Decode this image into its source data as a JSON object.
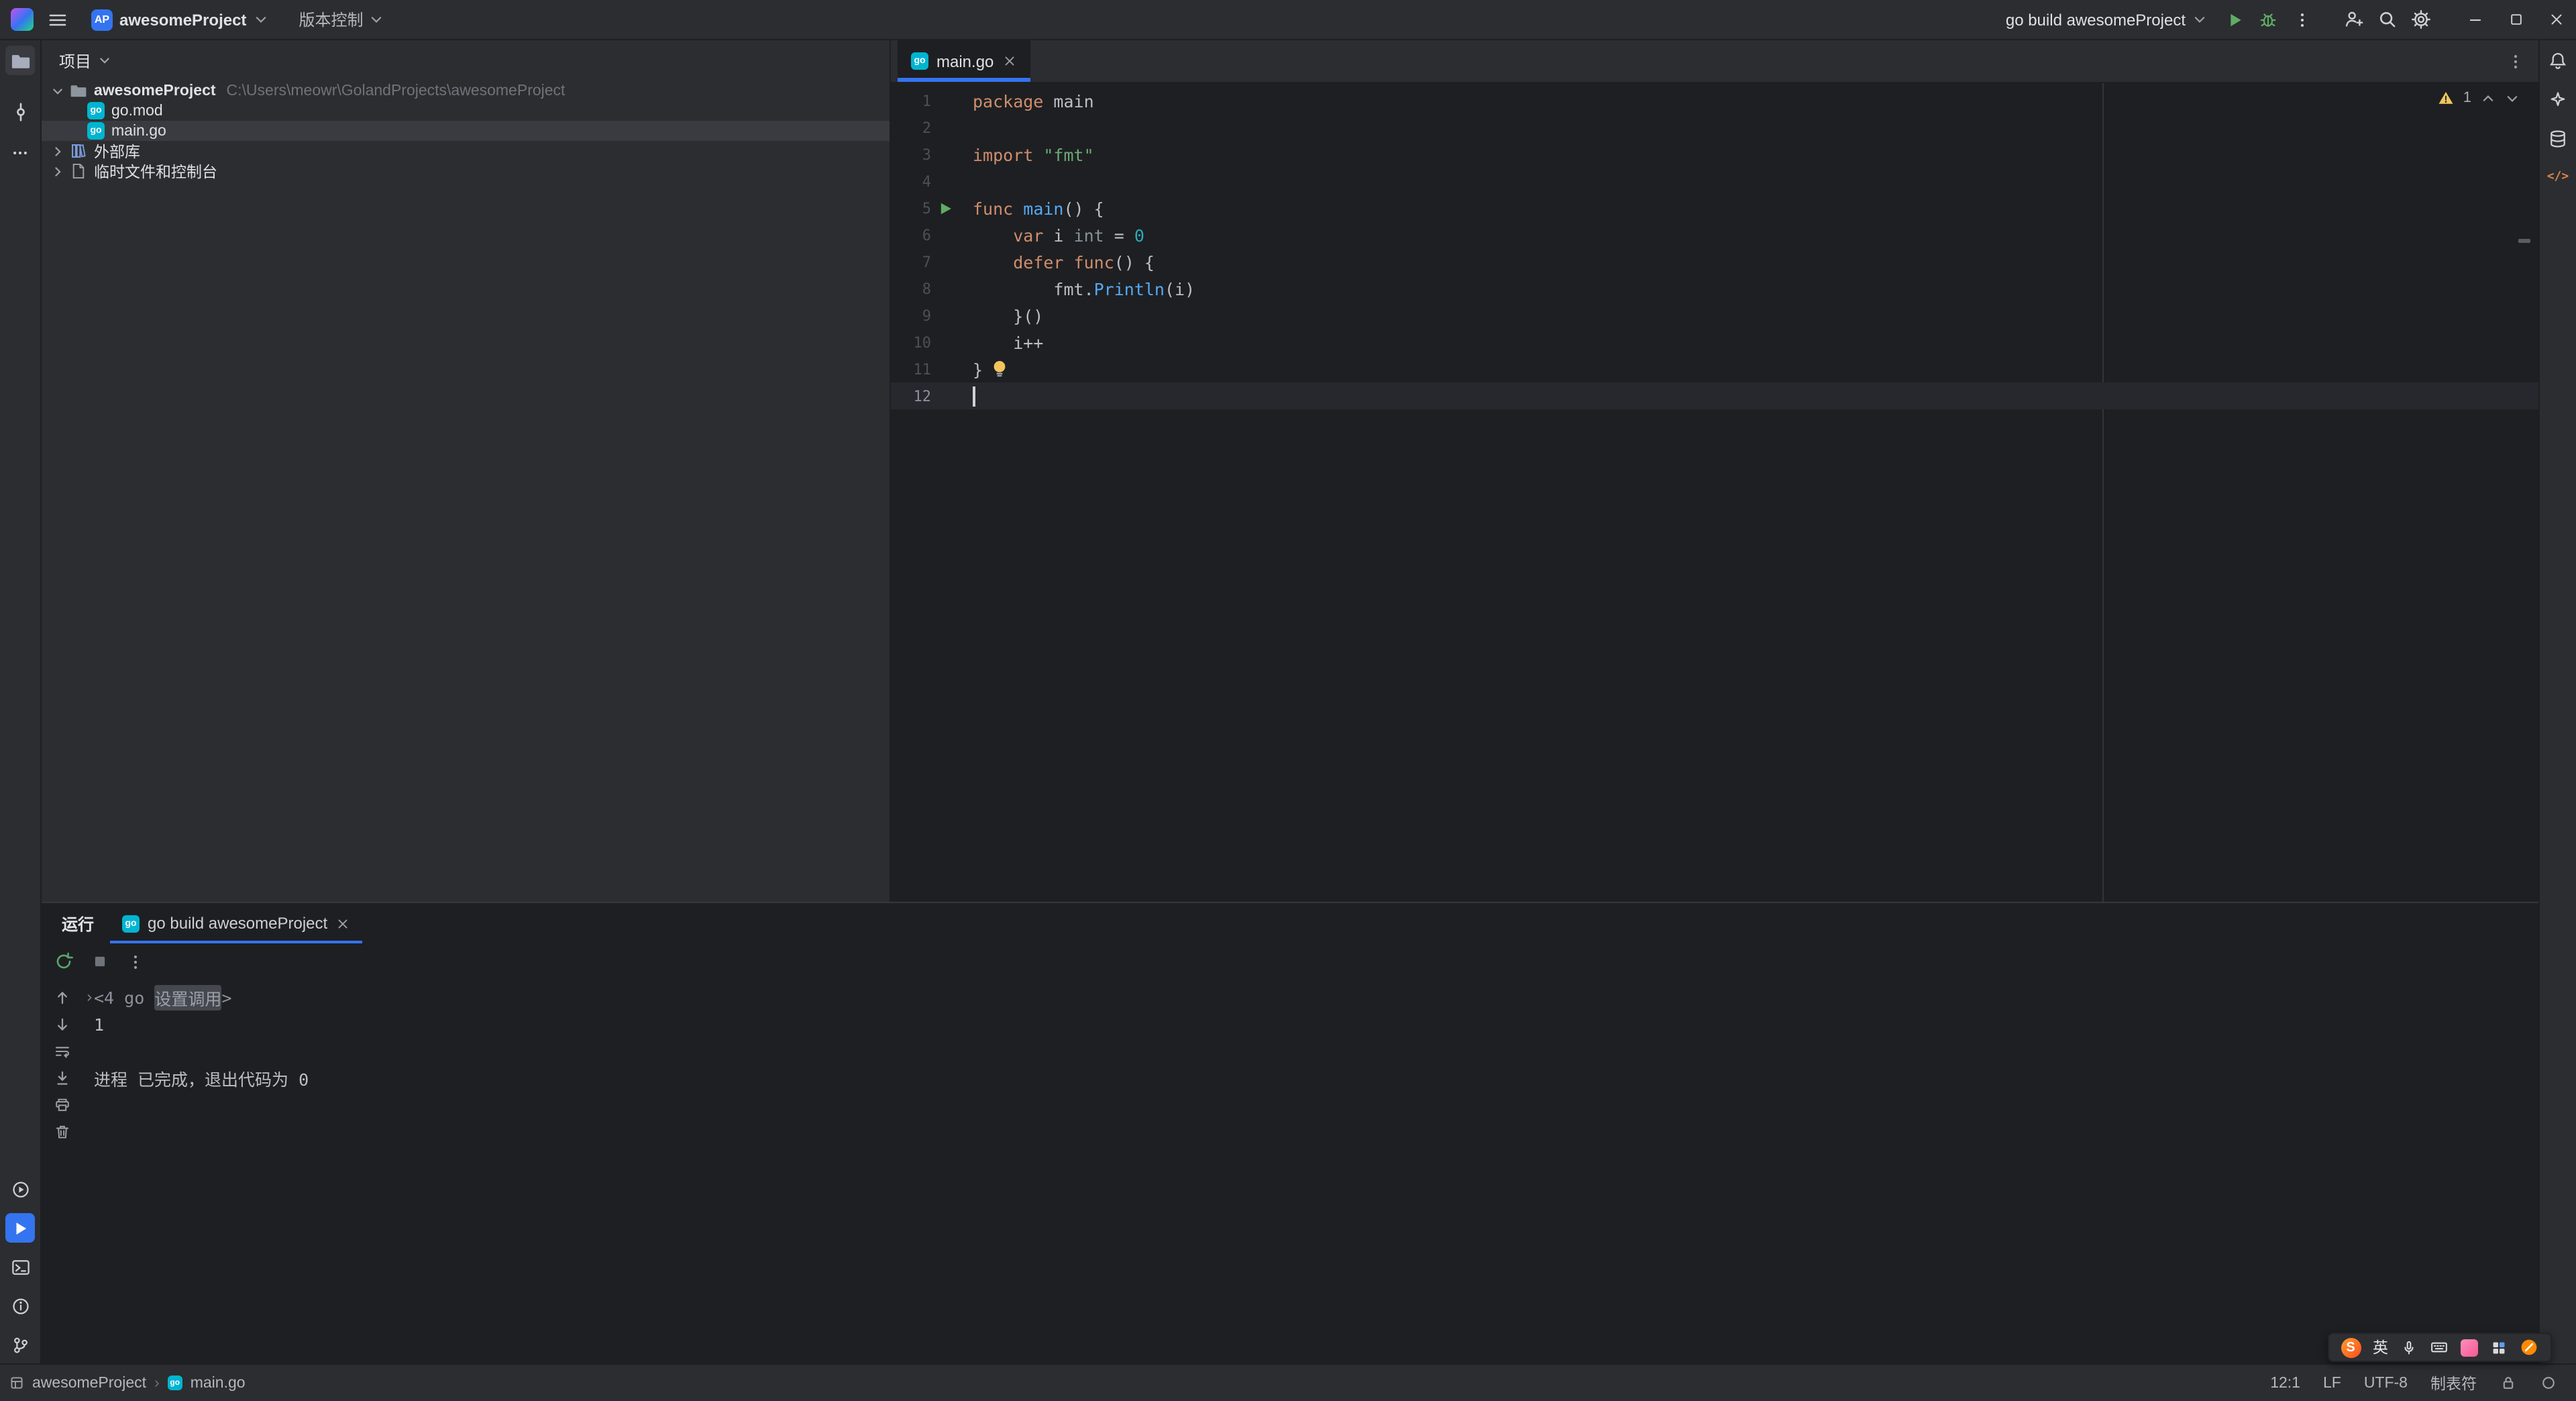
{
  "app": {
    "title_badge": "AP",
    "project_name": "awesomeProject",
    "vcs_label": "版本控制",
    "run_config_label": "go build awesomeProject"
  },
  "icons": {
    "go_badge": "go",
    "code_tag": "</>"
  },
  "project_panel": {
    "title": "项目",
    "root_label": "awesomeProject",
    "root_path": "C:\\Users\\meowr\\GolandProjects\\awesomeProject",
    "item_gomod": "go.mod",
    "item_maingo": "main.go",
    "item_external_libraries": "外部库",
    "item_scratches": "临时文件和控制台"
  },
  "editor": {
    "tab_label": "main.go",
    "warning_count": "1",
    "lines": [
      {
        "num": "1",
        "tokens": [
          {
            "text": "package",
            "style": "keyword"
          },
          {
            "text": " main",
            "style": "plain"
          }
        ]
      },
      {
        "num": "2",
        "tokens": []
      },
      {
        "num": "3",
        "tokens": [
          {
            "text": "import",
            "style": "keyword"
          },
          {
            "text": " ",
            "style": "plain"
          },
          {
            "text": "\"fmt\"",
            "style": "string"
          }
        ]
      },
      {
        "num": "4",
        "tokens": []
      },
      {
        "num": "5",
        "run_marker": true,
        "tokens": [
          {
            "text": "func",
            "style": "keyword"
          },
          {
            "text": " ",
            "style": "plain"
          },
          {
            "text": "main",
            "style": "function"
          },
          {
            "text": "() {",
            "style": "plain"
          }
        ]
      },
      {
        "num": "6",
        "tokens": [
          {
            "text": "    ",
            "style": "plain"
          },
          {
            "text": "var",
            "style": "keyword"
          },
          {
            "text": " i ",
            "style": "plain"
          },
          {
            "text": "int",
            "style": "type"
          },
          {
            "text": " = ",
            "style": "plain"
          },
          {
            "text": "0",
            "style": "number"
          }
        ]
      },
      {
        "num": "7",
        "tokens": [
          {
            "text": "    ",
            "style": "plain"
          },
          {
            "text": "defer",
            "style": "keyword"
          },
          {
            "text": " ",
            "style": "plain"
          },
          {
            "text": "func",
            "style": "keyword"
          },
          {
            "text": "() {",
            "style": "plain"
          }
        ]
      },
      {
        "num": "8",
        "tokens": [
          {
            "text": "        fmt.",
            "style": "plain"
          },
          {
            "text": "Println",
            "style": "function"
          },
          {
            "text": "(i)",
            "style": "plain"
          }
        ]
      },
      {
        "num": "9",
        "tokens": [
          {
            "text": "    }()",
            "style": "plain"
          }
        ]
      },
      {
        "num": "10",
        "tokens": [
          {
            "text": "    i++",
            "style": "plain"
          }
        ]
      },
      {
        "num": "11",
        "lightbulb": true,
        "tokens": [
          {
            "text": "}",
            "style": "plain"
          }
        ]
      },
      {
        "num": "12",
        "current": true,
        "caret": true,
        "tokens": []
      }
    ]
  },
  "run_panel": {
    "title": "运行",
    "tab_label": "go build awesomeProject",
    "fold_glyph": "›",
    "console_lines": [
      {
        "fold_arrow": true,
        "tokens": [
          {
            "text": "<4 go ",
            "style": "dim"
          },
          {
            "text": "设置调用",
            "style": "folded"
          },
          {
            "text": ">",
            "style": "dim"
          }
        ]
      },
      {
        "tokens": [
          {
            "text": "1",
            "style": "plain"
          }
        ]
      },
      {
        "tokens": []
      },
      {
        "tokens": [
          {
            "text": "进程 已完成，退出代码为 0",
            "style": "plain"
          }
        ]
      }
    ]
  },
  "statusbar": {
    "module": "awesomeProject",
    "separator": "›",
    "file": "main.go",
    "caret_position": "12:1",
    "line_separator": "LF",
    "encoding": "UTF-8",
    "indent_style": "制表符"
  },
  "ime": {
    "logo": "S",
    "mode": "英"
  }
}
